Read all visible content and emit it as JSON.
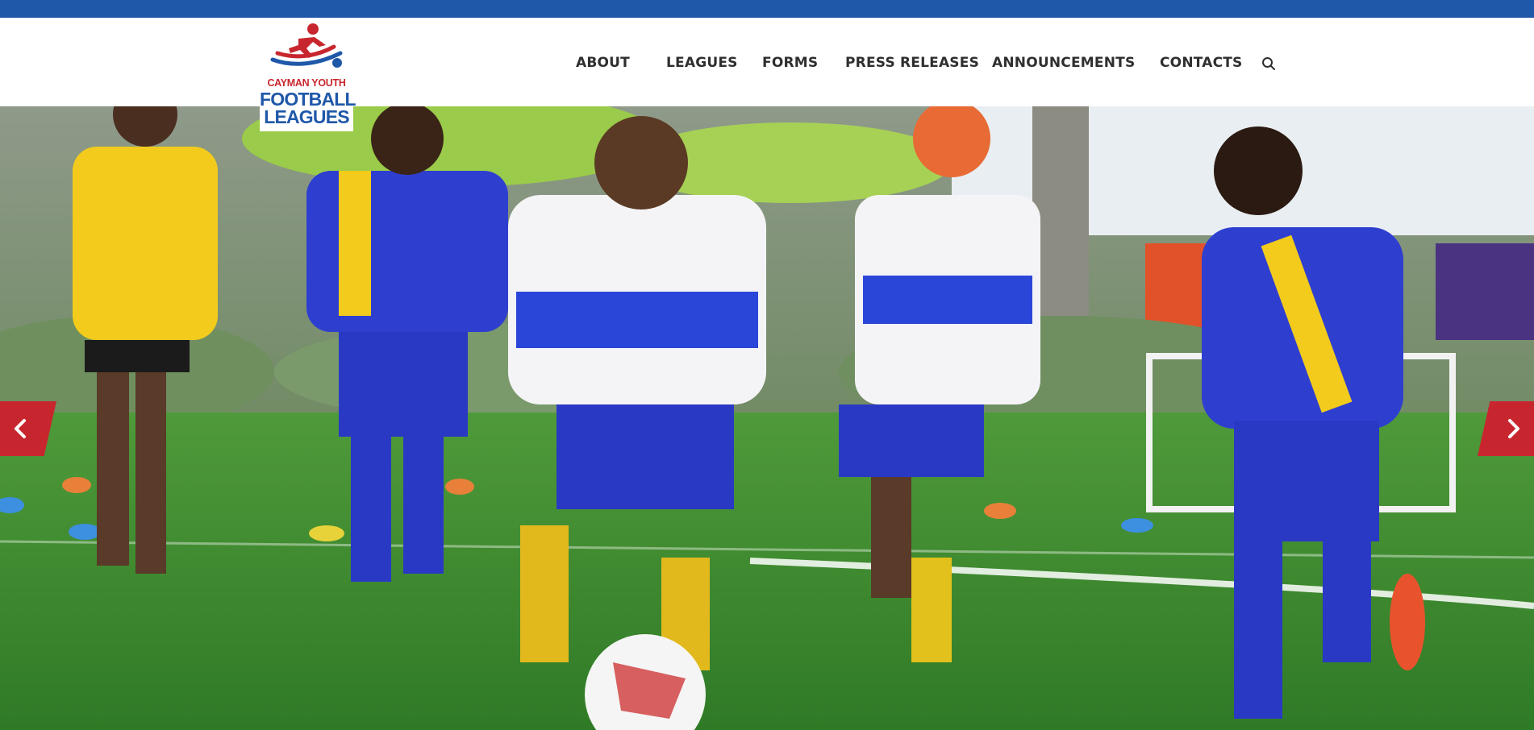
{
  "brand": {
    "logo_line1": "CAYMAN YOUTH",
    "logo_line2": "FOOTBALL",
    "logo_line3": "LEAGUES",
    "primary_color": "#1f58a9",
    "accent_color": "#c8262e"
  },
  "nav": {
    "items": [
      {
        "label": "ABOUT"
      },
      {
        "label": "LEAGUES"
      },
      {
        "label": "FORMS"
      },
      {
        "label": "PRESS RELEASES"
      },
      {
        "label": "ANNOUNCEMENTS"
      },
      {
        "label": "CONTACTS"
      }
    ],
    "search_icon": "search-icon"
  },
  "hero": {
    "image": "youth-girls-football-match-photo",
    "prev_icon": "chevron-left-icon",
    "next_icon": "chevron-right-icon"
  }
}
